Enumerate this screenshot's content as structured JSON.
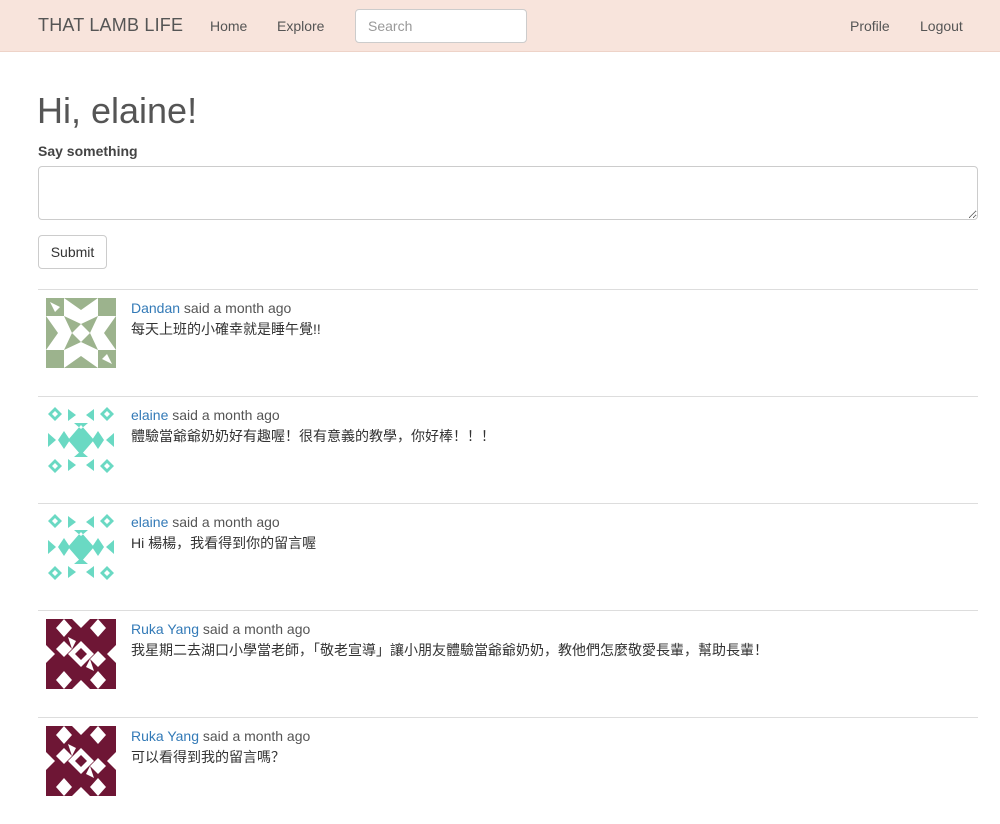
{
  "navbar": {
    "brand": "THAT LAMB LIFE",
    "home": "Home",
    "explore": "Explore",
    "search_placeholder": "Search",
    "profile": "Profile",
    "logout": "Logout"
  },
  "main": {
    "greeting": "Hi, elaine!",
    "say_label": "Say something",
    "say_value": "",
    "submit_label": "Submit"
  },
  "colors": {
    "navbar_bg": "#f8e4dc",
    "link": "#337ab7",
    "avatar_green": "#9cb38d",
    "avatar_teal": "#6ad9c3",
    "avatar_maroon": "#6e1635"
  },
  "posts": [
    {
      "author": "Dandan",
      "said": " said a month ago",
      "body": "每天上班的小確幸就是睡午覺!!",
      "avatar": "identicon-green"
    },
    {
      "author": "elaine",
      "said": " said a month ago",
      "body": "體驗當爺爺奶奶好有趣喔！很有意義的教學，你好棒！！！",
      "avatar": "identicon-teal"
    },
    {
      "author": "elaine",
      "said": " said a month ago",
      "body": "Hi 楊楊，我看得到你的留言喔",
      "avatar": "identicon-teal"
    },
    {
      "author": "Ruka Yang",
      "said": " said a month ago",
      "body": "我星期二去湖口小學當老師，「敬老宣導」讓小朋友體驗當爺爺奶奶，教他們怎麼敬愛長輩，幫助長輩！",
      "avatar": "identicon-maroon"
    },
    {
      "author": "Ruka Yang",
      "said": " said a month ago",
      "body": "可以看得到我的留言嗎？",
      "avatar": "identicon-maroon"
    }
  ]
}
